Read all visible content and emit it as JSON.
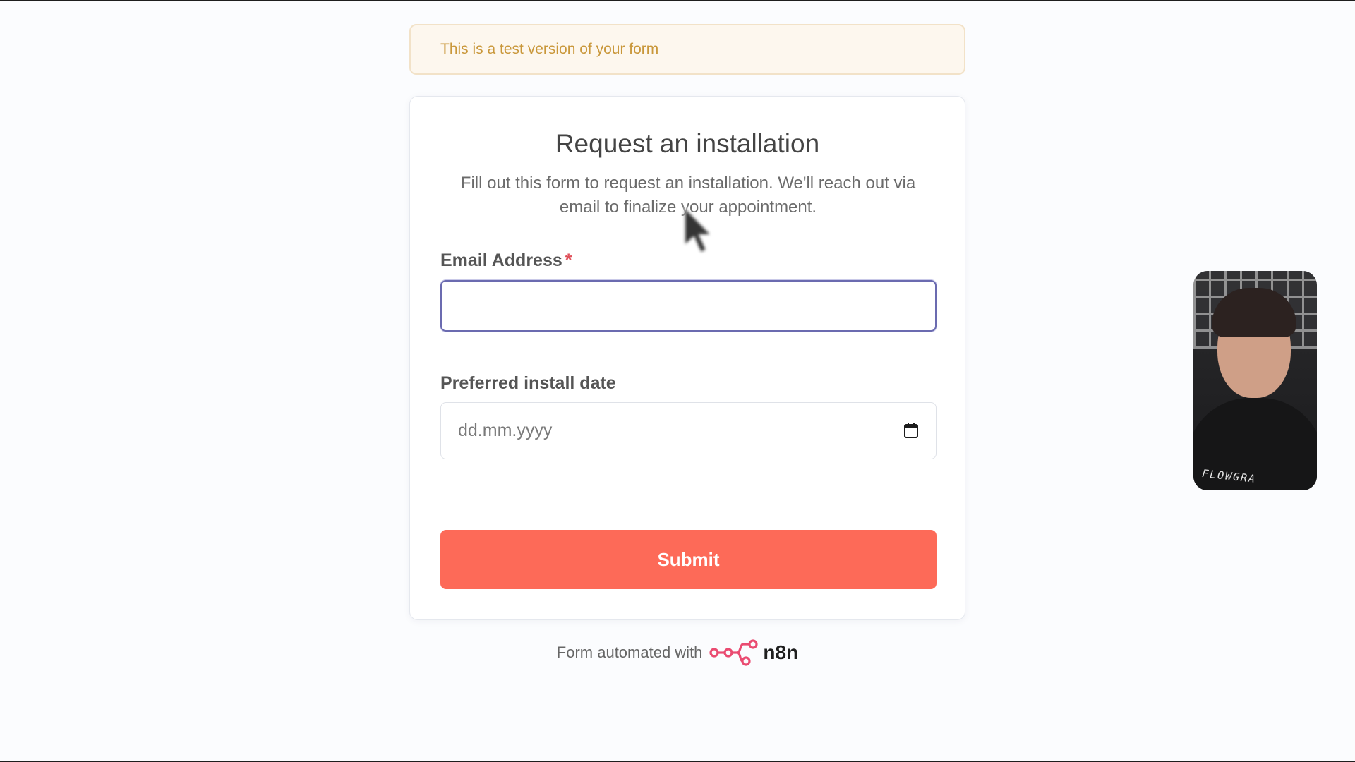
{
  "banner": {
    "text": "This is a test version of your form"
  },
  "form": {
    "title": "Request an installation",
    "description": "Fill out this form to request an installation. We'll reach out via email to finalize your appointment.",
    "fields": [
      {
        "label": "Email Address",
        "required_marker": "*",
        "value": "",
        "type": "email"
      },
      {
        "label": "Preferred install date",
        "placeholder": "dd.mm.yyyy",
        "value": "",
        "type": "date"
      }
    ],
    "submit_label": "Submit"
  },
  "footer": {
    "text": "Form automated with",
    "brand_name": "n8n",
    "logo_icon": "n8n-logo-icon"
  },
  "webcam": {
    "shirt_text": "FLOWGRA"
  },
  "colors": {
    "accent": "#fd6a58",
    "banner_bg": "#fdf7ee",
    "banner_text": "#c9973a",
    "required": "#e0505a",
    "focus_border": "#6b6bb0",
    "brand_pink": "#ea4b71"
  }
}
